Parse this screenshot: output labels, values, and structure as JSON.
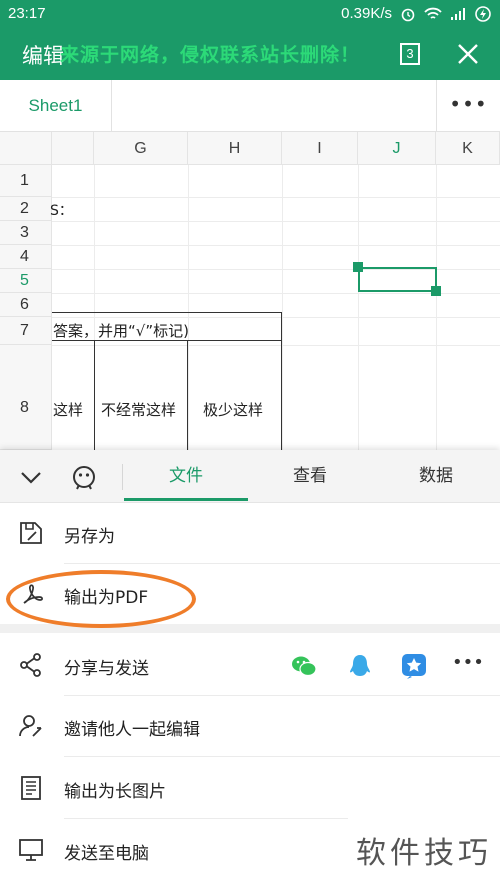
{
  "status_bar": {
    "time": "23:17",
    "speed": "0.39K/s"
  },
  "app_bar": {
    "title": "编辑",
    "watermark": "来源于网络，侵权联系站长删除！",
    "sheet_count": "3"
  },
  "sheet_tabs": {
    "active_sheet": "Sheet1",
    "more": "•••"
  },
  "grid": {
    "columns": [
      "G",
      "H",
      "I",
      "J",
      "K"
    ],
    "rows": [
      "1",
      "2",
      "3",
      "4",
      "5",
      "6",
      "7",
      "8"
    ],
    "active_row": "5",
    "active_col": "J",
    "cells": {
      "r2_text": "S：",
      "r7_text": "答案，并用“√”标记)",
      "r8_col1": "这样",
      "r8_col2": "不经常这样",
      "r8_col3": "极少这样"
    }
  },
  "bottom_sheet": {
    "tabs": [
      "文件",
      "查看",
      "数据"
    ],
    "active_tab": "文件",
    "items": [
      {
        "label": "另存为",
        "icon": "save-as-icon"
      },
      {
        "label": "输出为PDF",
        "icon": "pdf-icon"
      },
      {
        "label": "分享与发送",
        "icon": "share-icon"
      },
      {
        "label": "邀请他人一起编辑",
        "icon": "invite-user-icon"
      },
      {
        "label": "输出为长图片",
        "icon": "long-image-icon"
      },
      {
        "label": "发送至电脑",
        "icon": "computer-icon"
      }
    ],
    "share_more": "•••"
  },
  "corner_watermark": "软件技巧",
  "colors": {
    "brand": "#1b9a68",
    "highlight": "#ef7d2a"
  }
}
